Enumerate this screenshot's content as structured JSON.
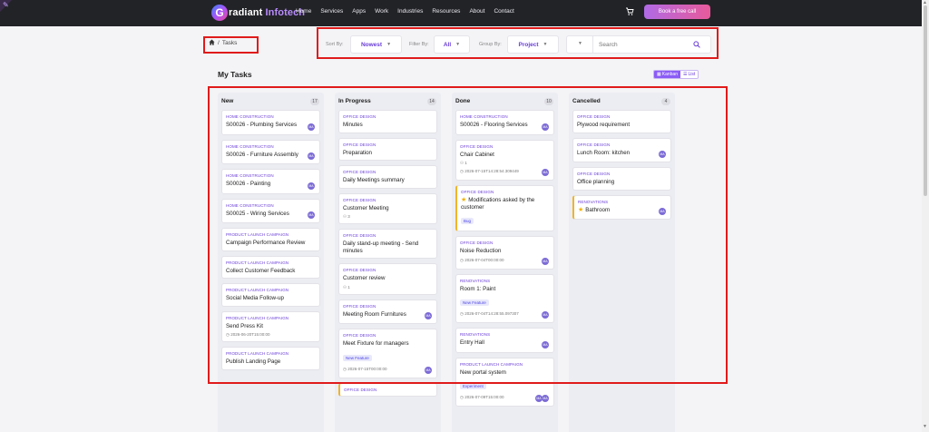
{
  "nav": {
    "logo_g": "G",
    "logo_rest": "radiant",
    "logo_hl": "Infotech",
    "links": [
      "Home",
      "Services",
      "Apps",
      "Work",
      "Industries",
      "Resources",
      "About",
      "Contact"
    ],
    "cart_icon": "cart-icon",
    "cta": "Book a free call"
  },
  "breadcrumb": {
    "home_icon": "home-icon",
    "sep": "/",
    "current": "Tasks"
  },
  "filters": {
    "sort_label": "Sort By:",
    "sort_value": "Nowest",
    "filter_label": "Filter By:",
    "filter_value": "All",
    "group_label": "Group By:",
    "group_value": "Project",
    "search_placeholder": "Search"
  },
  "page_title": "My Tasks",
  "view_toggle": {
    "kanban": "Kanban",
    "list": "List",
    "active": "kanban"
  },
  "columns": [
    {
      "title": "New",
      "count": "17",
      "cards": [
        {
          "project": "HOME CONSTRUCTION",
          "title": "S00026 - Plumbing Services",
          "avatar": "MA"
        },
        {
          "project": "HOME CONSTRUCTION",
          "title": "S00026 - Furniture Assembly",
          "avatar": "MA"
        },
        {
          "project": "HOME CONSTRUCTION",
          "title": "S00026 - Painting",
          "avatar": "MA"
        },
        {
          "project": "HOME CONSTRUCTION",
          "title": "S00025 - Wiring Services",
          "avatar": "MA"
        },
        {
          "project": "PRODUCT LAUNCH CAMPAIGN",
          "title": "Campaign Performance Review"
        },
        {
          "project": "PRODUCT LAUNCH CAMPAIGN",
          "title": "Collect Customer Feedback"
        },
        {
          "project": "PRODUCT LAUNCH CAMPAIGN",
          "title": "Social Media Follow-up"
        },
        {
          "project": "PRODUCT LAUNCH CAMPAIGN",
          "title": "Send Press Kit",
          "date": "2026-06-20T15:00:00"
        },
        {
          "project": "PRODUCT LAUNCH CAMPAIGN",
          "title": "Publish Landing Page"
        }
      ]
    },
    {
      "title": "In Progress",
      "count": "14",
      "cards": [
        {
          "project": "OFFICE DESIGN",
          "title": "Minutes"
        },
        {
          "project": "OFFICE DESIGN",
          "title": "Preparation"
        },
        {
          "project": "OFFICE DESIGN",
          "title": "Daily Meetings summary"
        },
        {
          "project": "OFFICE DESIGN",
          "title": "Customer Meeting",
          "sub": "3"
        },
        {
          "project": "OFFICE DESIGN",
          "title": "Daily stand-up meeting - Send minutes"
        },
        {
          "project": "OFFICE DESIGN",
          "title": "Customer review",
          "sub": "1"
        },
        {
          "project": "OFFICE DESIGN",
          "title": "Meeting Room Furnitures",
          "avatar": "MA"
        },
        {
          "project": "OFFICE DESIGN",
          "title": "Meet Fixture for managers",
          "tag": "New Feature",
          "date": "2026-07-15T00:00:00",
          "avatar": "MA"
        },
        {
          "project": "OFFICE DESIGN",
          "title": "",
          "lb": true
        }
      ]
    },
    {
      "title": "Done",
      "count": "10",
      "cards": [
        {
          "project": "HOME CONSTRUCTION",
          "title": "S00026 - Flooring Services",
          "avatar": "MA"
        },
        {
          "project": "OFFICE DESIGN",
          "title": "Chair Cabinet",
          "date": "2026-07-15T14:28:54.309449",
          "sub": "1",
          "avatar": "MA"
        },
        {
          "project": "OFFICE DESIGN",
          "title": "Modifications asked by the customer",
          "star": true,
          "tag": "Bug",
          "lb": true
        },
        {
          "project": "OFFICE DESIGN",
          "title": "Noise Reduction",
          "date": "2026-07-04T00:00:00",
          "avatar": "MA"
        },
        {
          "project": "RENOVATIONS",
          "title": "Room 1: Paint",
          "tag": "New Feature",
          "date": "2026-07-04T14:28:55.097307",
          "avatar": "MA"
        },
        {
          "project": "RENOVATIONS",
          "title": "Entry Hall",
          "avatar": "MA"
        },
        {
          "project": "PRODUCT LAUNCH CAMPAIGN",
          "title": "New portal system",
          "tag": "Experiment",
          "date": "2026-07-09T15:00:00",
          "avatar": "MA",
          "avatar2": "MA"
        }
      ]
    },
    {
      "title": "Cancelled",
      "count": "4",
      "cards": [
        {
          "project": "OFFICE DESIGN",
          "title": "Plywood requirement"
        },
        {
          "project": "OFFICE DESIGN",
          "title": "Lunch Room: kitchen",
          "avatar": "MA"
        },
        {
          "project": "OFFICE DESIGN",
          "title": "Office planning"
        },
        {
          "project": "RENOVATIONS",
          "title": "Bathroom",
          "star": true,
          "avatar": "MA",
          "lb": true
        }
      ]
    }
  ]
}
